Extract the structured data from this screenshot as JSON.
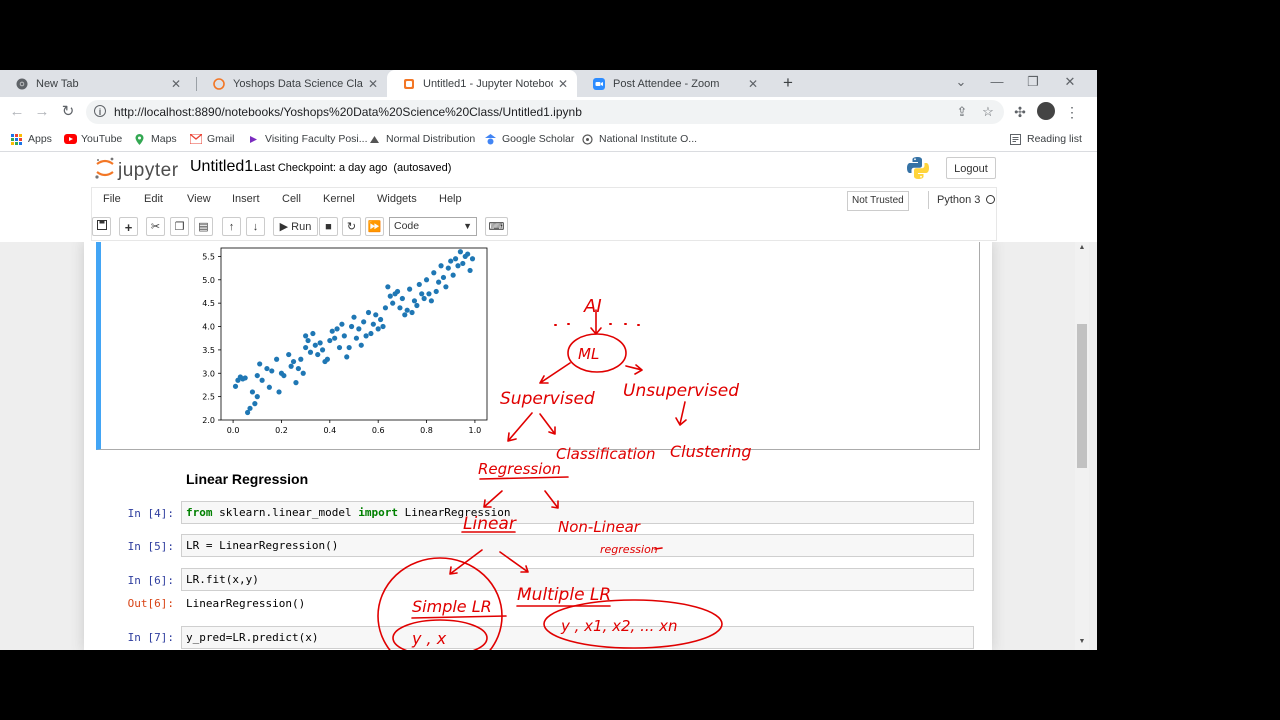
{
  "browser": {
    "tabs": [
      {
        "label": "New Tab",
        "icon": "chrome-icon"
      },
      {
        "label": "Yoshops Data Science Class/",
        "icon": "jupyter-icon"
      },
      {
        "label": "Untitled1 - Jupyter Notebook",
        "icon": "jupyter-icon",
        "active": true
      },
      {
        "label": "Post Attendee - Zoom",
        "icon": "zoom-icon"
      }
    ],
    "url": "http://localhost:8890/notebooks/Yoshops%20Data%20Science%20Class/Untitled1.ipynb",
    "bookmarks": [
      {
        "label": "Apps",
        "icon": "apps-grid-icon"
      },
      {
        "label": "YouTube",
        "icon": "youtube-icon"
      },
      {
        "label": "Maps",
        "icon": "maps-icon"
      },
      {
        "label": "Gmail",
        "icon": "gmail-icon"
      },
      {
        "label": "Visiting Faculty Posi...",
        "icon": "bookmark-site-icon"
      },
      {
        "label": "Normal Distribution",
        "icon": "bookmark-site-icon"
      },
      {
        "label": "Google Scholar",
        "icon": "scholar-icon"
      },
      {
        "label": "National Institute O...",
        "icon": "bookmark-site-icon"
      }
    ],
    "reading_list": "Reading list"
  },
  "jupyter": {
    "logo_text": "jupyter",
    "notebook_title": "Untitled1",
    "checkpoint": "Last Checkpoint: a day ago",
    "autosave": "(autosaved)",
    "logout": "Logout",
    "menus": [
      "File",
      "Edit",
      "View",
      "Insert",
      "Cell",
      "Kernel",
      "Widgets",
      "Help"
    ],
    "trust": "Not Trusted",
    "kernel": "Python 3",
    "run_label": "Run",
    "cell_type": "Code"
  },
  "notebook": {
    "heading": "Linear Regression",
    "cells": [
      {
        "prompt": "In [4]:",
        "code": [
          {
            "t": "from",
            "kw": true
          },
          {
            "t": " sklearn.linear_model "
          },
          {
            "t": "import",
            "kw": true
          },
          {
            "t": " LinearRegression"
          }
        ]
      },
      {
        "prompt": "In [5]:",
        "code": [
          {
            "t": "LR = LinearRegression()"
          }
        ]
      },
      {
        "prompt": "In [6]:",
        "code": [
          {
            "t": "LR.fit(x,y)"
          }
        ],
        "out_prompt": "Out[6]:",
        "output": "LinearRegression()"
      },
      {
        "prompt": "In [7]:",
        "code": [
          {
            "t": "y_pred=LR.predict(x)"
          }
        ]
      }
    ]
  },
  "chart_data": {
    "type": "scatter",
    "color": "#1f77b4",
    "xlim": [
      -0.05,
      1.05
    ],
    "ylim": [
      2.0,
      5.68
    ],
    "xticks": [
      "0.0",
      "0.2",
      "0.4",
      "0.6",
      "0.8",
      "1.0"
    ],
    "yticks": [
      "2.0",
      "2.5",
      "3.0",
      "3.5",
      "4.0",
      "4.5",
      "5.0",
      "5.5"
    ],
    "points": [
      [
        0.01,
        2.72
      ],
      [
        0.02,
        2.85
      ],
      [
        0.03,
        2.92
      ],
      [
        0.04,
        2.88
      ],
      [
        0.05,
        2.9
      ],
      [
        0.06,
        2.16
      ],
      [
        0.07,
        2.25
      ],
      [
        0.08,
        2.6
      ],
      [
        0.09,
        2.35
      ],
      [
        0.1,
        2.5
      ],
      [
        0.1,
        2.95
      ],
      [
        0.11,
        3.2
      ],
      [
        0.12,
        2.85
      ],
      [
        0.14,
        3.1
      ],
      [
        0.15,
        2.7
      ],
      [
        0.16,
        3.05
      ],
      [
        0.18,
        3.3
      ],
      [
        0.19,
        2.6
      ],
      [
        0.2,
        3.0
      ],
      [
        0.21,
        2.95
      ],
      [
        0.23,
        3.4
      ],
      [
        0.24,
        3.15
      ],
      [
        0.25,
        3.25
      ],
      [
        0.26,
        2.8
      ],
      [
        0.27,
        3.1
      ],
      [
        0.28,
        3.3
      ],
      [
        0.29,
        3.0
      ],
      [
        0.3,
        3.55
      ],
      [
        0.3,
        3.8
      ],
      [
        0.31,
        3.7
      ],
      [
        0.32,
        3.45
      ],
      [
        0.33,
        3.85
      ],
      [
        0.34,
        3.6
      ],
      [
        0.35,
        3.4
      ],
      [
        0.36,
        3.65
      ],
      [
        0.37,
        3.5
      ],
      [
        0.38,
        3.25
      ],
      [
        0.39,
        3.3
      ],
      [
        0.4,
        3.7
      ],
      [
        0.41,
        3.9
      ],
      [
        0.42,
        3.75
      ],
      [
        0.43,
        3.95
      ],
      [
        0.44,
        3.55
      ],
      [
        0.45,
        4.05
      ],
      [
        0.46,
        3.8
      ],
      [
        0.47,
        3.35
      ],
      [
        0.48,
        3.55
      ],
      [
        0.49,
        4.0
      ],
      [
        0.5,
        4.2
      ],
      [
        0.51,
        3.75
      ],
      [
        0.52,
        3.95
      ],
      [
        0.53,
        3.6
      ],
      [
        0.54,
        4.1
      ],
      [
        0.55,
        3.8
      ],
      [
        0.56,
        4.3
      ],
      [
        0.57,
        3.85
      ],
      [
        0.58,
        4.05
      ],
      [
        0.59,
        4.25
      ],
      [
        0.6,
        3.95
      ],
      [
        0.61,
        4.15
      ],
      [
        0.62,
        4.0
      ],
      [
        0.63,
        4.4
      ],
      [
        0.64,
        4.85
      ],
      [
        0.65,
        4.65
      ],
      [
        0.66,
        4.5
      ],
      [
        0.67,
        4.7
      ],
      [
        0.68,
        4.75
      ],
      [
        0.69,
        4.4
      ],
      [
        0.7,
        4.6
      ],
      [
        0.71,
        4.25
      ],
      [
        0.72,
        4.35
      ],
      [
        0.73,
        4.8
      ],
      [
        0.74,
        4.3
      ],
      [
        0.75,
        4.55
      ],
      [
        0.76,
        4.45
      ],
      [
        0.77,
        4.9
      ],
      [
        0.78,
        4.7
      ],
      [
        0.79,
        4.6
      ],
      [
        0.8,
        5.0
      ],
      [
        0.81,
        4.7
      ],
      [
        0.82,
        4.55
      ],
      [
        0.83,
        5.15
      ],
      [
        0.84,
        4.75
      ],
      [
        0.85,
        4.95
      ],
      [
        0.86,
        5.3
      ],
      [
        0.87,
        5.05
      ],
      [
        0.88,
        4.85
      ],
      [
        0.89,
        5.25
      ],
      [
        0.9,
        5.4
      ],
      [
        0.91,
        5.1
      ],
      [
        0.92,
        5.45
      ],
      [
        0.93,
        5.3
      ],
      [
        0.94,
        5.6
      ],
      [
        0.95,
        5.35
      ],
      [
        0.96,
        5.5
      ],
      [
        0.97,
        5.55
      ],
      [
        0.98,
        5.2
      ],
      [
        0.99,
        5.45
      ]
    ]
  },
  "annotations": {
    "color": "#e00000",
    "words": [
      "AI",
      "ML",
      "Supervised",
      "Unsupervised",
      "Classification",
      "Clustering",
      "Regression",
      "Linear",
      "Non-Linear",
      "regression",
      "Simple LR",
      "Multiple LR",
      "y , x",
      "y , x1, x2, ... xn"
    ]
  }
}
